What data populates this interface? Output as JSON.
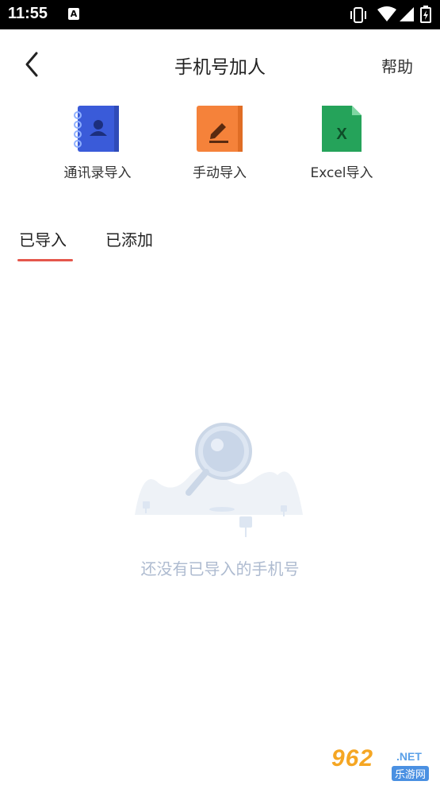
{
  "status_bar": {
    "time": "11:55",
    "notification_icon": "A"
  },
  "header": {
    "title": "手机号加人",
    "help_label": "帮助"
  },
  "imports": [
    {
      "label": "通讯录导入",
      "icon": "contacts-book-icon",
      "color": "#3a5bd9"
    },
    {
      "label": "手动导入",
      "icon": "pencil-icon",
      "color": "#f5823a"
    },
    {
      "label": "Excel导入",
      "icon": "excel-file-icon",
      "color": "#25a35a"
    }
  ],
  "tabs": [
    {
      "label": "已导入",
      "active": true
    },
    {
      "label": "已添加",
      "active": false
    }
  ],
  "empty_state": {
    "message": "还没有已导入的手机号"
  },
  "watermark": {
    "main": "962",
    "net": ".NET",
    "sub": "乐游网"
  },
  "colors": {
    "accent": "#e5574c",
    "empty_text": "#aebbd0"
  }
}
